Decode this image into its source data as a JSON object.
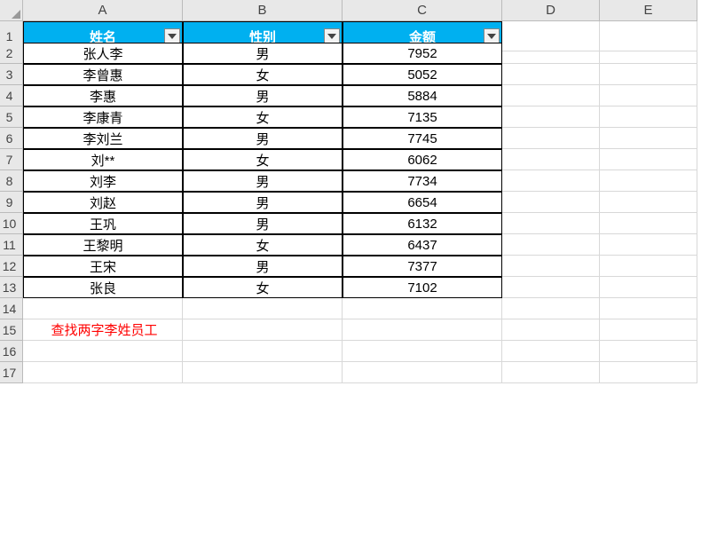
{
  "columns": [
    "A",
    "B",
    "C",
    "D",
    "E"
  ],
  "rownums": [
    "1",
    "2",
    "3",
    "4",
    "5",
    "6",
    "7",
    "8",
    "9",
    "10",
    "11",
    "12",
    "13",
    "14",
    "15",
    "16",
    "17"
  ],
  "headers": {
    "name": "姓名",
    "gender": "性别",
    "amount": "金额"
  },
  "rows": [
    {
      "name": "张人李",
      "gender": "男",
      "amount": "7952"
    },
    {
      "name": "李曾惠",
      "gender": "女",
      "amount": "5052"
    },
    {
      "name": "李惠",
      "gender": "男",
      "amount": "5884"
    },
    {
      "name": "李康青",
      "gender": "女",
      "amount": "7135"
    },
    {
      "name": "李刘兰",
      "gender": "男",
      "amount": "7745"
    },
    {
      "name": "刘**",
      "gender": "女",
      "amount": "6062"
    },
    {
      "name": "刘李",
      "gender": "男",
      "amount": "7734"
    },
    {
      "name": "刘赵",
      "gender": "男",
      "amount": "6654"
    },
    {
      "name": "王巩",
      "gender": "男",
      "amount": "6132"
    },
    {
      "name": "王黎明",
      "gender": "女",
      "amount": "6437"
    },
    {
      "name": "王宋",
      "gender": "男",
      "amount": "7377"
    },
    {
      "name": "张良",
      "gender": "女",
      "amount": "7102"
    }
  ],
  "note": "查找两字李姓员工",
  "chart_data": {
    "type": "table",
    "columns": [
      "姓名",
      "性别",
      "金额"
    ],
    "data": [
      [
        "张人李",
        "男",
        7952
      ],
      [
        "李曾惠",
        "女",
        5052
      ],
      [
        "李惠",
        "男",
        5884
      ],
      [
        "李康青",
        "女",
        7135
      ],
      [
        "李刘兰",
        "男",
        7745
      ],
      [
        "刘**",
        "女",
        6062
      ],
      [
        "刘李",
        "男",
        7734
      ],
      [
        "刘赵",
        "男",
        6654
      ],
      [
        "王巩",
        "男",
        6132
      ],
      [
        "王黎明",
        "女",
        6437
      ],
      [
        "王宋",
        "男",
        7377
      ],
      [
        "张良",
        "女",
        7102
      ]
    ]
  }
}
